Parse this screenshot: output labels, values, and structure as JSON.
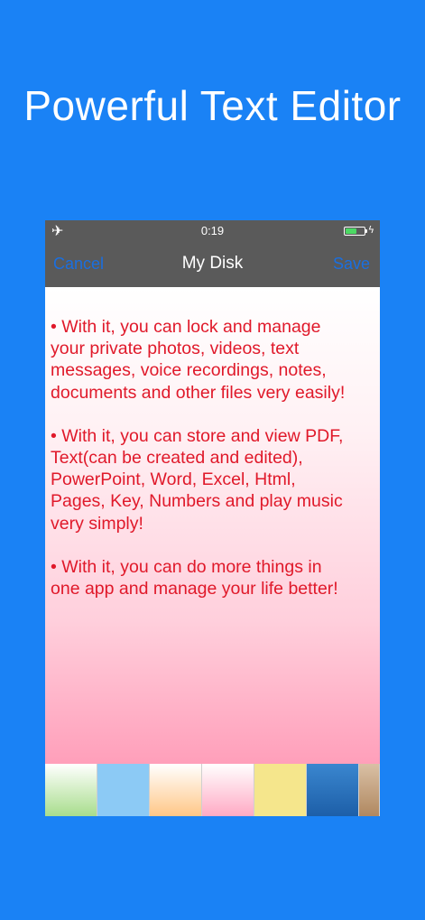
{
  "headline": "Powerful Text Editor",
  "status_bar": {
    "time": "0:19",
    "airplane_icon": "airplane-icon",
    "battery_icon": "battery-icon",
    "battery_level": 0.6,
    "charging_icon": "charging-bolt-icon"
  },
  "nav_bar": {
    "cancel_label": "Cancel",
    "title": "My Disk",
    "save_label": "Save"
  },
  "editor": {
    "paragraphs": [
      "•  With it, you can lock and manage\nyour private photos, videos, text\nmessages, voice recordings, notes,\ndocuments and other files very easily!",
      "•  With it, you can store and view PDF,\nText(can be created and edited),\nPowerPoint, Word, Excel, Html,\nPages, Key, Numbers and play music\nvery simply!",
      "•  With it, you can do more things in\none app and manage your life better!"
    ],
    "text_color": "#e0192a"
  },
  "background_swatches": [
    {
      "name": "green-gradient",
      "top": "#ffffff",
      "bottom": "#a8dd8c"
    },
    {
      "name": "light-blue",
      "top": "#8ccaf5",
      "bottom": "#8ccaf5"
    },
    {
      "name": "orange-gradient",
      "top": "#ffffff",
      "bottom": "#ffc787"
    },
    {
      "name": "pink-gradient",
      "top": "#ffffff",
      "bottom": "#ffaac4"
    },
    {
      "name": "yellow",
      "top": "#f5e68c",
      "bottom": "#f5e68c"
    },
    {
      "name": "blue-gradient",
      "top": "#3a86cf",
      "bottom": "#1d5fa8"
    },
    {
      "name": "tan-gradient",
      "top": "#d9c0a5",
      "bottom": "#b08860"
    }
  ],
  "colors": {
    "page_background": "#1a82f5",
    "bar_background": "#5a5a5a",
    "nav_button": "#1a6fe0"
  }
}
